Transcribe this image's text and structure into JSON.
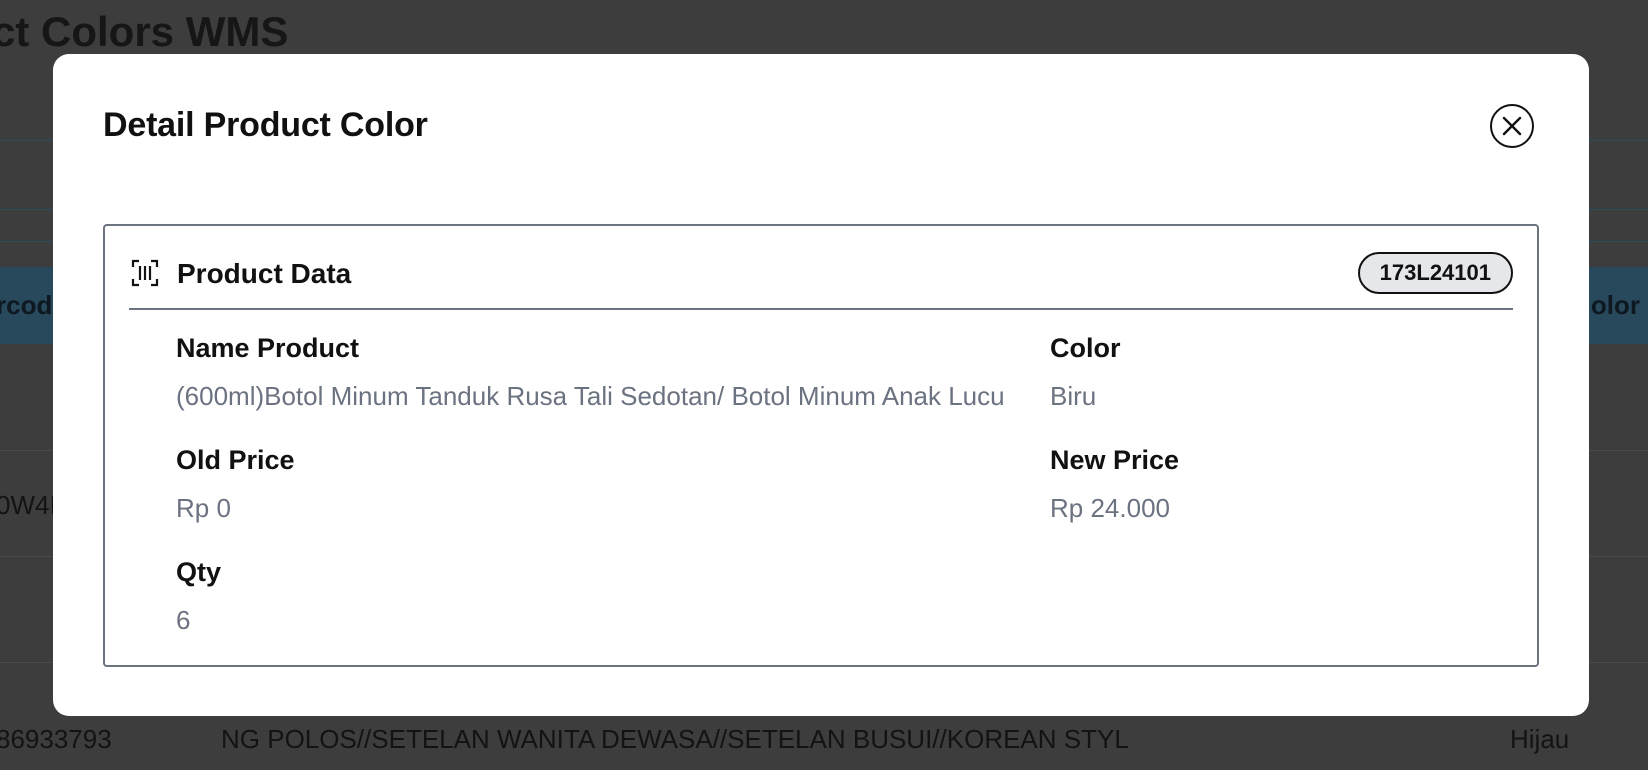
{
  "background": {
    "page_title": "ct Colors WMS",
    "table_header_left": "rcod",
    "table_header_right": "olor",
    "row_code_partial": "0W4I",
    "last_row": {
      "code": "86933793",
      "name": "NG POLOS//SETELAN WANITA DEWASA//SETELAN BUSUI//KOREAN STYL",
      "color": "Hijau"
    }
  },
  "modal": {
    "title": "Detail Product Color",
    "close_icon": "close-icon",
    "card": {
      "icon": "barcode-icon",
      "title": "Product Data",
      "code_badge": "173L24101",
      "fields": {
        "name_product_label": "Name Product",
        "name_product_value": "(600ml)Botol Minum Tanduk Rusa Tali Sedotan/ Botol Minum Anak Lucu",
        "color_label": "Color",
        "color_value": "Biru",
        "old_price_label": "Old Price",
        "old_price_value": "Rp 0",
        "new_price_label": "New Price",
        "new_price_value": "Rp 24.000",
        "qty_label": "Qty",
        "qty_value": "6"
      }
    }
  },
  "colors": {
    "overlay": "#3d3d3d",
    "label_text": "#111111",
    "value_text": "#6b7280",
    "badge_bg": "#e5e7eb"
  }
}
